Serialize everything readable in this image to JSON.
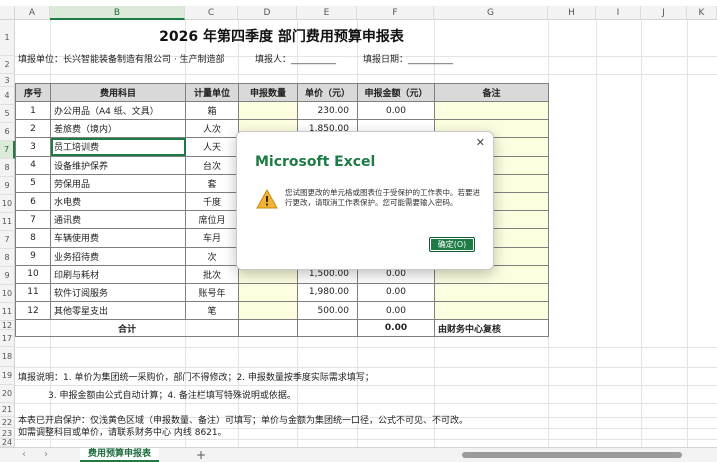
{
  "columns": [
    "A",
    "B",
    "C",
    "D",
    "E",
    "F",
    "G",
    "H",
    "I",
    "J",
    "K"
  ],
  "rows": [
    "1",
    "2",
    "3",
    "4",
    "5",
    "6",
    "7",
    "8",
    "9",
    "10",
    "11",
    "7",
    "8",
    "9",
    "10",
    "11",
    "12",
    "17",
    "18",
    "19",
    "20",
    "21",
    "22",
    "23",
    "24"
  ],
  "title": "2026 年第四季度 部门费用预算申报表",
  "info": {
    "unit": "填报单位：长兴智能装备制造有限公司 · 生产制造部",
    "reporter": "填报人：__________",
    "date": "填报日期：__________"
  },
  "table": {
    "headers": [
      "序号",
      "费用科目",
      "计量单位",
      "申报数量",
      "单价（元）",
      "申报金额（元）",
      "备注"
    ],
    "rows": [
      {
        "no": "1",
        "item": "办公用品（A4 纸、文具）",
        "unit": "箱",
        "qty": "",
        "price": "230.00",
        "amount": "0.00",
        "note": ""
      },
      {
        "no": "2",
        "item": "差旅费（境内）",
        "unit": "人次",
        "qty": "",
        "price": "1,850.00",
        "amount": "",
        "note": ""
      },
      {
        "no": "3",
        "item": "员工培训费",
        "unit": "人天",
        "qty": "",
        "price": "",
        "amount": "",
        "note": ""
      },
      {
        "no": "4",
        "item": "设备维护保养",
        "unit": "台次",
        "qty": "",
        "price": "",
        "amount": "",
        "note": ""
      },
      {
        "no": "5",
        "item": "劳保用品",
        "unit": "套",
        "qty": "",
        "price": "",
        "amount": "",
        "note": ""
      },
      {
        "no": "6",
        "item": "水电费",
        "unit": "千度",
        "qty": "",
        "price": "",
        "amount": "",
        "note": ""
      },
      {
        "no": "7",
        "item": "通讯费",
        "unit": "席位月",
        "qty": "",
        "price": "",
        "amount": "",
        "note": ""
      },
      {
        "no": "8",
        "item": "车辆使用费",
        "unit": "车月",
        "qty": "",
        "price": "",
        "amount": "",
        "note": ""
      },
      {
        "no": "9",
        "item": "业务招待费",
        "unit": "次",
        "qty": "",
        "price": "",
        "amount": "",
        "note": ""
      },
      {
        "no": "10",
        "item": "印刷与耗材",
        "unit": "批次",
        "qty": "",
        "price": "1,500.00",
        "amount": "0.00",
        "note": ""
      },
      {
        "no": "11",
        "item": "软件订阅服务",
        "unit": "账号年",
        "qty": "",
        "price": "1,980.00",
        "amount": "0.00",
        "note": ""
      },
      {
        "no": "12",
        "item": "其他零星支出",
        "unit": "笔",
        "qty": "",
        "price": "500.00",
        "amount": "0.00",
        "note": ""
      }
    ],
    "total_label": "合计",
    "total_amount": "0.00",
    "total_note": "由财务中心复核"
  },
  "notes": {
    "line1": "填报说明：1. 单价为集团统一采购价，部门不得修改；2. 申报数量按季度实际需求填写；",
    "line2": "3. 申报金额由公式自动计算；4. 备注栏填写特殊说明或依据。",
    "line3": "本表已开启保护：仅浅黄色区域（申报数量、备注）可填写；单价与金额为集团统一口径，公式不可见、不可改。",
    "line4": "如需调整科目或单价，请联系财务中心 内线 8621。"
  },
  "tabs": {
    "active": "费用预算申报表",
    "add": "+",
    "prev": "‹",
    "next": "›"
  },
  "dialog": {
    "title": "Microsoft Excel",
    "message": "您试图更改的单元格或图表位于受保护的工作表中。若要进行更改，请取消工作表保护。您可能需要输入密码。",
    "ok": "确定(O)",
    "close": "✕"
  },
  "colors": {
    "accent": "#1e7b45",
    "header_fill": "#d9d9d9",
    "input_fill": "#fdfde0"
  },
  "selected_cell": "B7"
}
